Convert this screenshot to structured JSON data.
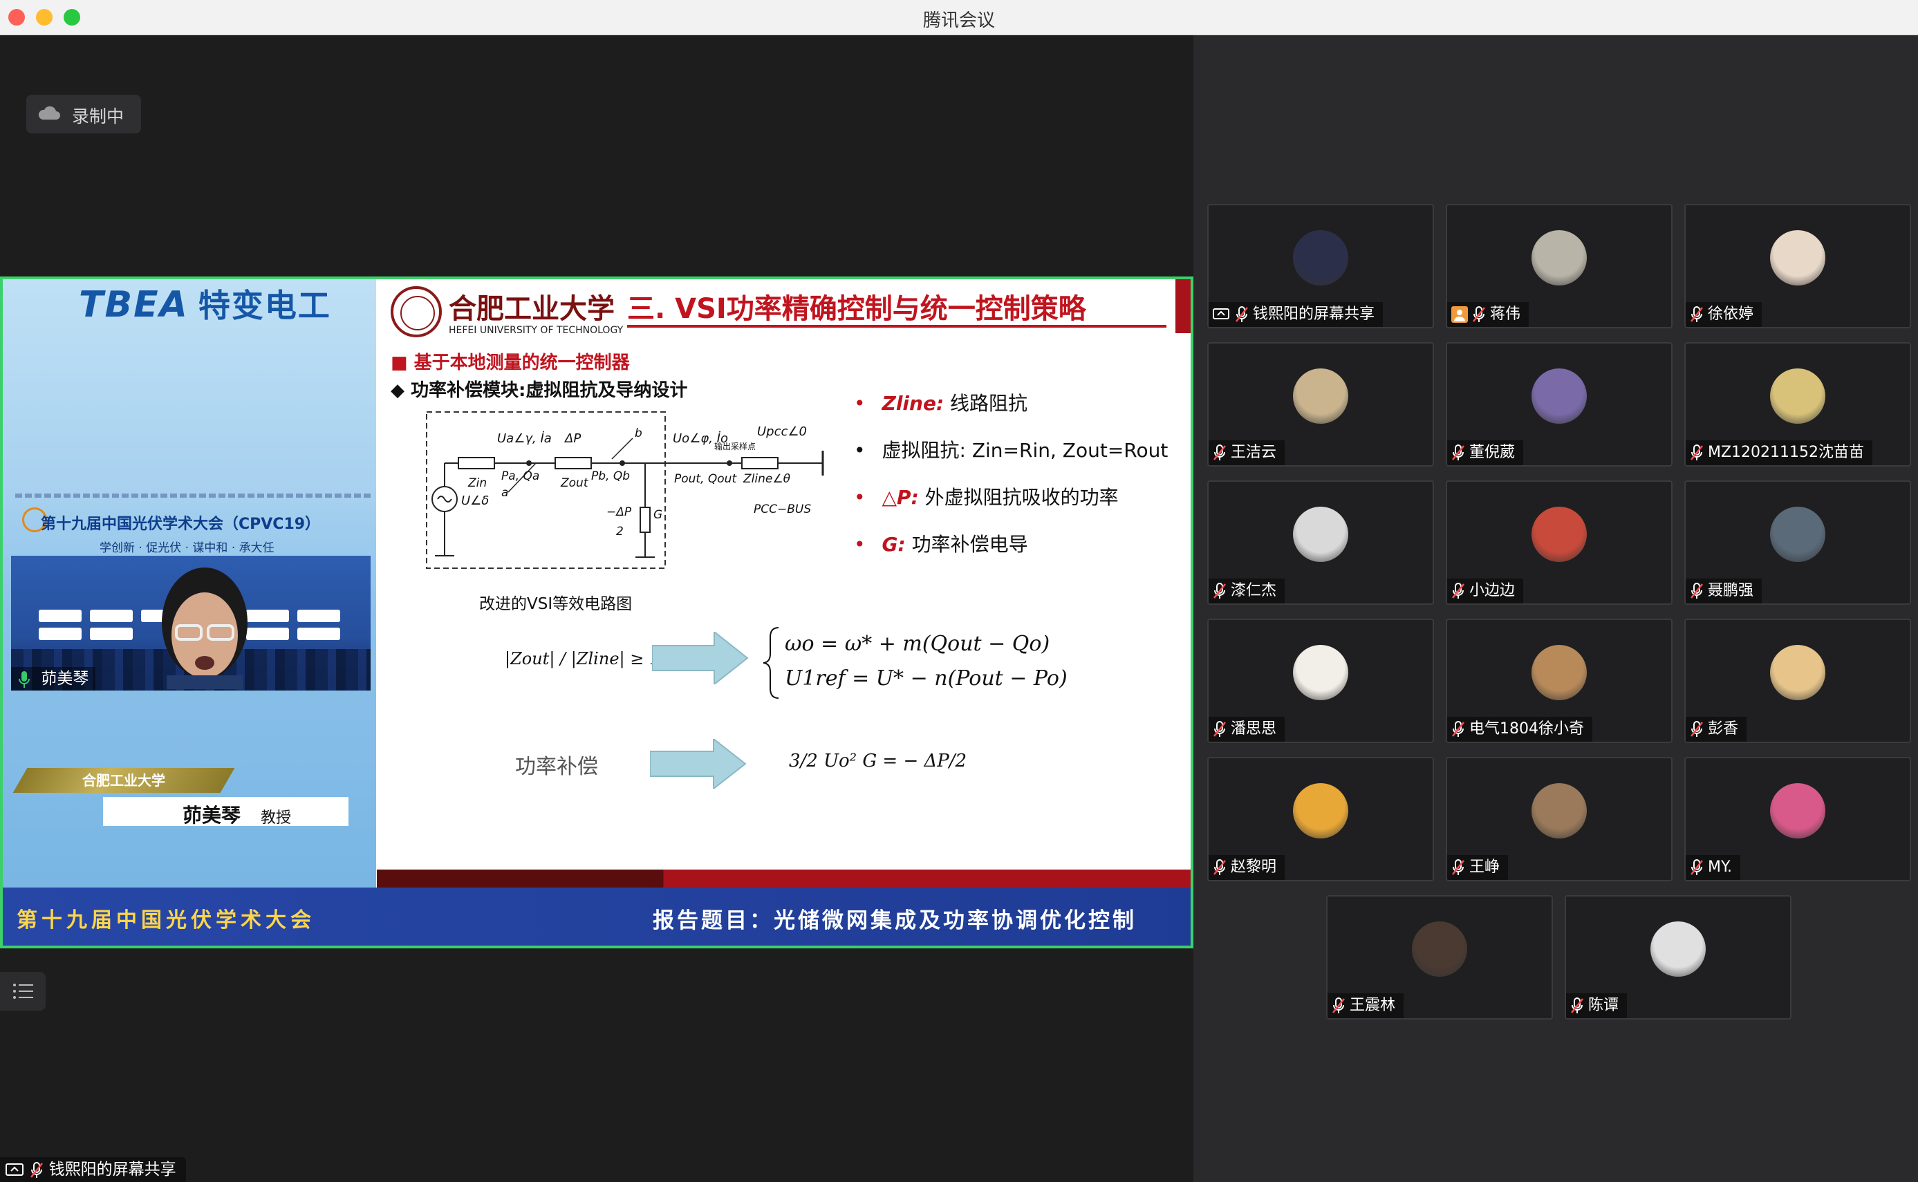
{
  "window": {
    "title": "腾讯会议"
  },
  "recording": {
    "label": "录制中"
  },
  "share": {
    "brand": "TBEA",
    "brand_cn": "特变电工",
    "conference_title": "第十九届中国光伏学术大会（CPVC19）",
    "conference_motto": "学创新 · 促光伏 · 谋中和 · 承大任",
    "speaker_cam_name": "茆美琴",
    "name_plate_org": "合肥工业大学",
    "name_plate_name": "茆美琴",
    "name_plate_title": "教授",
    "slide": {
      "university_cn": "合肥工业大学",
      "university_en": "HEFEI UNIVERSITY OF TECHNOLOGY",
      "title": "三. VSI功率精确控制与统一控制策略",
      "bullet1": "■  基于本地测量的统一控制器",
      "bullet2": "◆  功率补偿模块:虚拟阻抗及导纳设计",
      "list": [
        {
          "key": "Zline:",
          "text": " 线路阻抗"
        },
        {
          "key": "",
          "text": "虚拟阻抗:  Zin=Rin,  Zout=Rout"
        },
        {
          "key": "△P:",
          "text": " 外虚拟阻抗吸收的功率"
        },
        {
          "key": "G:",
          "text": " 功率补偿电导"
        }
      ],
      "circuit_caption": "改进的VSI等效电路图",
      "formula_ratio": "|Zout| / |Zline| ≥ 10",
      "formula_omega": "ωo = ω* + m(Qout − Qo)",
      "formula_u": "U1ref = U* − n(Pout − Po)",
      "compensation_label": "功率补偿",
      "formula_comp": "3/2 Uo² G = − ΔP/2",
      "circuit_labels": {
        "ua": "Ua∠γ, İa",
        "dp": "ΔP",
        "zin": "Zin",
        "paqa": "Pa, Qa",
        "zout": "Zout",
        "pbqb": "Pb, Qb",
        "uo": "Uo∠φ, İo",
        "sample": "输出采样点",
        "upcc": "Upcc∠0",
        "pout": "Pout, Qout",
        "zline": "Zline∠θ",
        "src": "U∠δ",
        "ndp": "−ΔP",
        "two": "2",
        "g": "G",
        "a": "a",
        "b": "b",
        "bus": "PCC−BUS"
      }
    },
    "footer_left": "第十九届中国光伏学术大会",
    "footer_right": "报告题目：光储微网集成及功率协调优化控制"
  },
  "bottom_label": "钱熙阳的屏幕共享",
  "participants": [
    {
      "name": "钱熙阳的屏幕共享",
      "color": "#2b2f4a",
      "extra": "share"
    },
    {
      "name": "蒋伟",
      "color": "#b9b4a8",
      "extra": "user"
    },
    {
      "name": "徐依婷",
      "color": "#e8d8c8",
      "extra": ""
    },
    {
      "name": "王洁云",
      "color": "#c9b48e",
      "extra": ""
    },
    {
      "name": "董倪葳",
      "color": "#7a6aa8",
      "extra": ""
    },
    {
      "name": "MZ120211152沈苗苗",
      "color": "#d8c27a",
      "extra": ""
    },
    {
      "name": "漆仁杰",
      "color": "#d9d9d9",
      "extra": ""
    },
    {
      "name": "小边边",
      "color": "#c84a3a",
      "extra": ""
    },
    {
      "name": "聂鹏强",
      "color": "#5a6a78",
      "extra": ""
    },
    {
      "name": "潘思思",
      "color": "#f2efe8",
      "extra": ""
    },
    {
      "name": "电气1804徐小奇",
      "color": "#b88a5a",
      "extra": ""
    },
    {
      "name": "彭香",
      "color": "#e6c48a",
      "extra": ""
    },
    {
      "name": "赵黎明",
      "color": "#e8a838",
      "extra": ""
    },
    {
      "name": "王峥",
      "color": "#9a7a5a",
      "extra": ""
    },
    {
      "name": "MY.",
      "color": "#d85a8a",
      "extra": ""
    },
    {
      "name": "王震林",
      "color": "#4a3a32",
      "extra": ""
    },
    {
      "name": "陈谭",
      "color": "#e0e0e0",
      "extra": ""
    }
  ]
}
